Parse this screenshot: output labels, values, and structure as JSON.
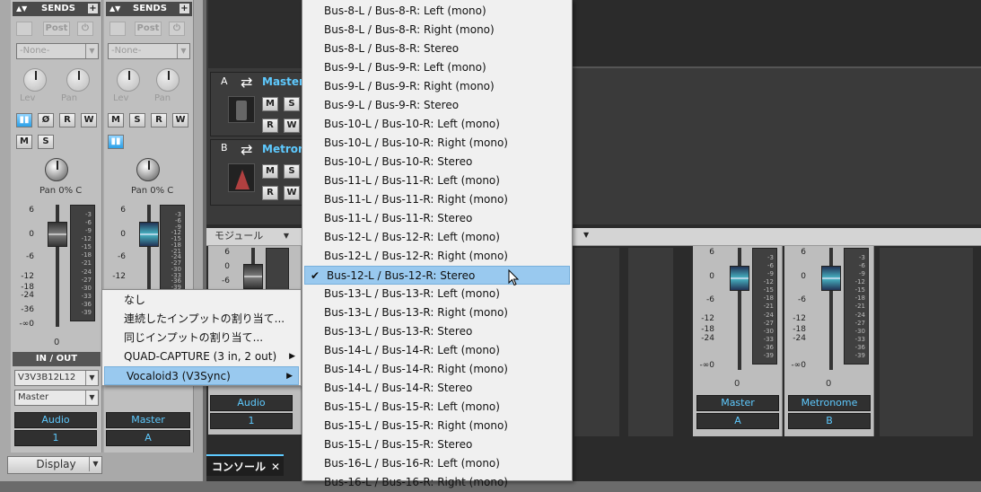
{
  "strips": [
    {
      "sends": "SENDS",
      "post": "Post",
      "none": "-None-",
      "lev": "Lev",
      "pan": "Pan",
      "pan_val": "Pan 0% C",
      "zero": "0",
      "io": "IN / OUT",
      "input": "V3V3B12L12",
      "output": "Master",
      "name": "Audio",
      "num": "1"
    },
    {
      "sends": "SENDS",
      "post": "Post",
      "none": "-None-",
      "lev": "Lev",
      "pan": "Pan",
      "pan_val": "Pan 0% C",
      "name": "Master",
      "num": "A"
    }
  ],
  "buttons": {
    "m": "M",
    "s": "S",
    "r": "R",
    "w": "W",
    "phase": "Ø",
    "mute_s": "M",
    "solo_s": "S"
  },
  "scale": [
    "6",
    "0",
    "-6",
    "-12",
    "-18",
    "-24",
    "-36",
    "-∞0"
  ],
  "meter_scale": [
    "-3",
    "-6",
    "-9",
    "-12",
    "-15",
    "-18",
    "-21",
    "-24",
    "-27",
    "-30",
    "-33",
    "-36",
    "-39"
  ],
  "display_label": "Display",
  "tracks": [
    {
      "letter": "A",
      "name": "Master"
    },
    {
      "letter": "B",
      "name": "Metron"
    }
  ],
  "console": {
    "module": "モジュール",
    "tab": "コンソール",
    "name": "Audio",
    "num": "1",
    "scale": [
      "6",
      "0",
      "-6"
    ]
  },
  "right_strips": [
    {
      "name": "Master",
      "num": "A",
      "zero": "0"
    },
    {
      "name": "Metronome",
      "num": "B",
      "zero": "0"
    }
  ],
  "context_menu": {
    "items": [
      "なし",
      "連続したインプットの割り当て...",
      "同じインプットの割り当て...",
      "QUAD-CAPTURE (3 in, 2 out)",
      "Vocaloid3 (V3Sync)"
    ],
    "selected": 4
  },
  "bus_menu": {
    "items": [
      "Bus-8-L / Bus-8-R: Left (mono)",
      "Bus-8-L / Bus-8-R: Right (mono)",
      "Bus-8-L / Bus-8-R: Stereo",
      "Bus-9-L / Bus-9-R: Left (mono)",
      "Bus-9-L / Bus-9-R: Right (mono)",
      "Bus-9-L / Bus-9-R: Stereo",
      "Bus-10-L / Bus-10-R: Left (mono)",
      "Bus-10-L / Bus-10-R: Right (mono)",
      "Bus-10-L / Bus-10-R: Stereo",
      "Bus-11-L / Bus-11-R: Left (mono)",
      "Bus-11-L / Bus-11-R: Right (mono)",
      "Bus-11-L / Bus-11-R: Stereo",
      "Bus-12-L / Bus-12-R: Left (mono)",
      "Bus-12-L / Bus-12-R: Right (mono)",
      "Bus-12-L / Bus-12-R: Stereo",
      "Bus-13-L / Bus-13-R: Left (mono)",
      "Bus-13-L / Bus-13-R: Right (mono)",
      "Bus-13-L / Bus-13-R: Stereo",
      "Bus-14-L / Bus-14-R: Left (mono)",
      "Bus-14-L / Bus-14-R: Right (mono)",
      "Bus-14-L / Bus-14-R: Stereo",
      "Bus-15-L / Bus-15-R: Left (mono)",
      "Bus-15-L / Bus-15-R: Right (mono)",
      "Bus-15-L / Bus-15-R: Stereo",
      "Bus-16-L / Bus-16-R: Left (mono)",
      "Bus-16-L / Bus-16-R: Right (mono)"
    ],
    "checked": 14
  },
  "colors": {
    "accent": "#5ecaff",
    "selection": "#99c9ef"
  }
}
